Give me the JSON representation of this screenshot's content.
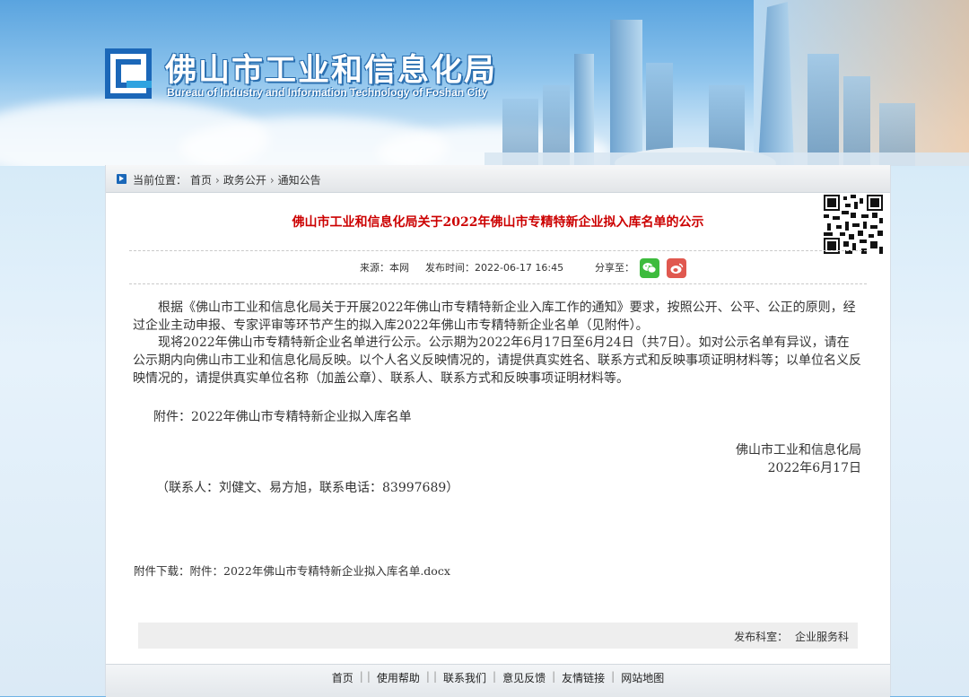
{
  "header": {
    "title_cn": "佛山市工业和信息化局",
    "title_en": "Bureau of Industry and Information Technology of Foshan City"
  },
  "breadcrumb": {
    "prefix": "当前位置：",
    "items": [
      "首页",
      "政务公开",
      "通知公告"
    ]
  },
  "article": {
    "title": "佛山市工业和信息化局关于2022年佛山市专精特新企业拟入库名单的公示",
    "source_label": "来源：本网",
    "time_label": "发布时间：2022-06-17 16:45",
    "share_label": "分享至：",
    "paragraphs": [
      "根据《佛山市工业和信息化局关于开展2022年佛山市专精特新企业入库工作的通知》要求，按照公开、公平、公正的原则，经过企业主动申报、专家评审等环节产生的拟入库2022年佛山市专精特新企业名单（见附件）。",
      "现将2022年佛山市专精特新企业名单进行公示。公示期为2022年6月17日至6月24日（共7日）。如对公示名单有异议，请在公示期内向佛山市工业和信息化局反映。以个人名义反映情况的，请提供真实姓名、联系方式和反映事项证明材料等；以单位名义反映情况的，请提供真实单位名称（加盖公章）、联系人、联系方式和反映事项证明材料等。"
    ],
    "attachment_line": "附件：2022年佛山市专精特新企业拟入库名单",
    "signature_org": "佛山市工业和信息化局",
    "signature_date": "2022年6月17日",
    "contact": "（联系人：刘健文、易方旭，联系电话：83997689）",
    "download_label": "附件下载：",
    "download_file": "附件：2022年佛山市专精特新企业拟入库名单.docx",
    "dept_label": "发布科室：",
    "dept_value": "企业服务科"
  },
  "footer": {
    "links": [
      "首页",
      "使用帮助",
      "联系我们",
      "意见反馈",
      "友情链接",
      "网站地图"
    ]
  },
  "colors": {
    "title_red": "#cc0000",
    "wechat_green": "#3dbb3d",
    "weibo_red": "#e0584f",
    "logo_blue": "#1b67b8"
  }
}
